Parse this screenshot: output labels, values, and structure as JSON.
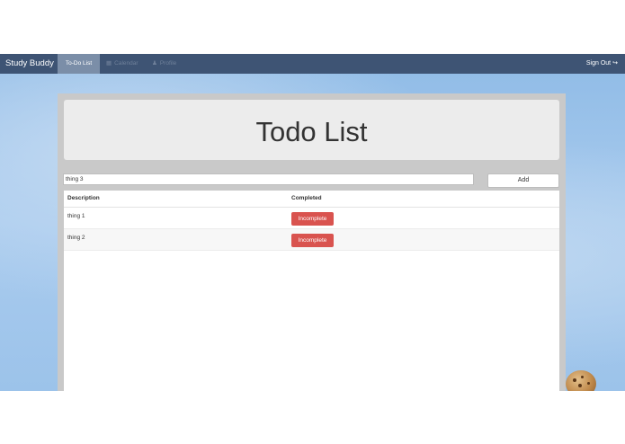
{
  "navbar": {
    "brand": "Study Buddy",
    "tabs": [
      {
        "label": "To-Do List",
        "icon": "none",
        "active": true
      },
      {
        "label": "Calendar",
        "icon": "calendar-icon",
        "active": false
      },
      {
        "label": "Profile",
        "icon": "user-icon",
        "active": false
      }
    ],
    "sign_out": "Sign Out",
    "sign_out_icon": "sign-out-icon"
  },
  "main": {
    "title": "Todo List",
    "new_todo_value": "thing 3",
    "add_label": "Add",
    "table": {
      "columns": [
        "Description",
        "Completed"
      ],
      "rows": [
        {
          "description": "thing 1",
          "status": "Incomplete"
        },
        {
          "description": "thing 2",
          "status": "Incomplete"
        }
      ]
    }
  },
  "colors": {
    "navbar": "#3e5474",
    "active_tab": "#7b8ea8",
    "incomplete_button": "#d9534f",
    "panel": "#c9c9c9"
  }
}
